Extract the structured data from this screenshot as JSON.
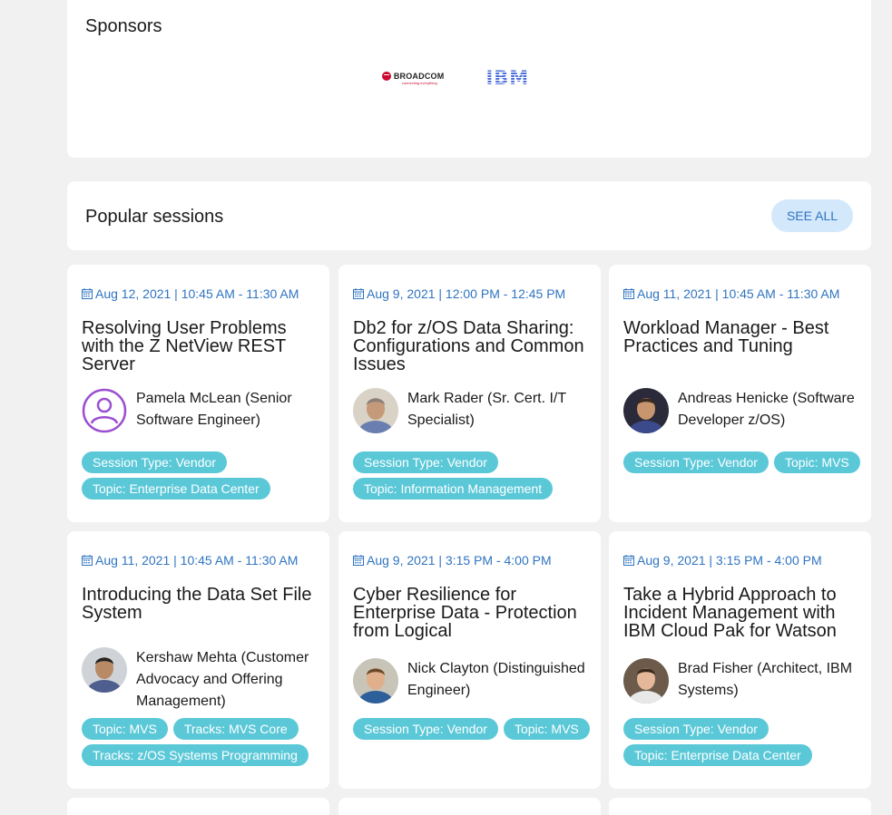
{
  "sponsors": {
    "heading": "Sponsors",
    "logos": [
      {
        "name": "BROADCOM",
        "tagline": "connecting everything",
        "color": "#cc092f"
      },
      {
        "name": "IBM",
        "color": "#4d6fd9"
      }
    ]
  },
  "popular": {
    "heading": "Popular sessions",
    "see_all": "SEE ALL"
  },
  "colors": {
    "accent_blue": "#2f74c0",
    "tag_bg": "#5bc8d8",
    "button_bg": "#d3e8fb"
  },
  "sessions": [
    {
      "date": "Aug 12, 2021 | 10:45 AM  -  11:30 AM",
      "title": "Resolving User Problems with the Z NetView REST Server",
      "speaker": "Pamela McLean (Senior Software Engineer)",
      "avatar": "placeholder-user-icon",
      "tags": [
        "Session Type: Vendor",
        "Topic: Enterprise Data Center"
      ]
    },
    {
      "date": "Aug 9, 2021 | 12:00 PM  -  12:45 PM",
      "title": "Db2 for z/OS Data Sharing: Configurations and Common Issues",
      "speaker": "Mark Rader (Sr. Cert. I/T Specialist)",
      "avatar": "photo",
      "tags": [
        "Session Type: Vendor",
        "Topic: Information Management"
      ]
    },
    {
      "date": "Aug 11, 2021 | 10:45 AM  -  11:30 AM",
      "title": "Workload Manager - Best Practices and Tuning",
      "speaker": "Andreas Henicke (Software Developer z/OS)",
      "avatar": "photo",
      "tags": [
        "Session Type: Vendor",
        "Topic: MVS"
      ]
    },
    {
      "date": "Aug 11, 2021 | 10:45 AM  -  11:30 AM",
      "title": "Introducing the Data Set File System",
      "speaker": "Kershaw Mehta (Customer Advocacy and Offering Management)",
      "avatar": "photo",
      "tags": [
        "Topic: MVS",
        "Tracks: MVS Core",
        "Tracks: z/OS Systems Programming"
      ]
    },
    {
      "date": "Aug 9, 2021 | 3:15 PM  -  4:00 PM",
      "title": "Cyber Resilience for Enterprise Data - Protection from Logical",
      "speaker": "Nick Clayton (Distinguished Engineer)",
      "avatar": "photo",
      "tags": [
        "Session Type: Vendor",
        "Topic: MVS"
      ]
    },
    {
      "date": "Aug 9, 2021 | 3:15 PM  -  4:00 PM",
      "title": "Take a Hybrid Approach to Incident Management with IBM Cloud Pak for Watson",
      "speaker": "Brad Fisher (Architect, IBM Systems)",
      "avatar": "photo",
      "tags": [
        "Session Type: Vendor",
        "Topic: Enterprise Data Center"
      ]
    }
  ]
}
